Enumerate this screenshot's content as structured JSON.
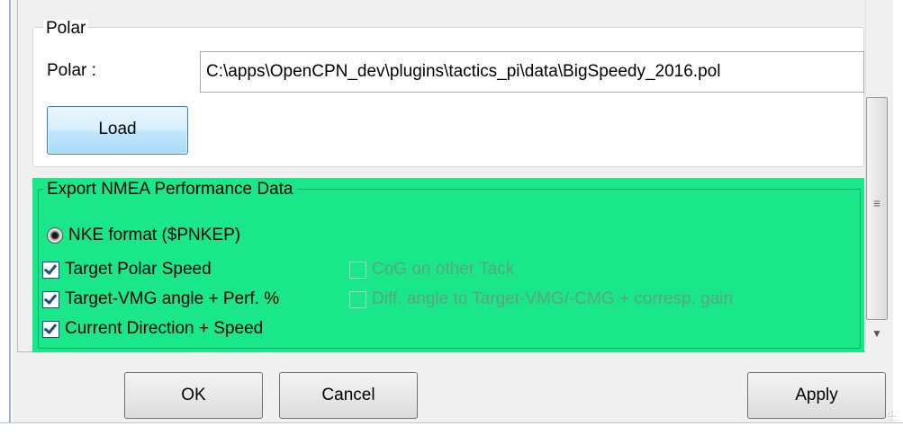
{
  "polar_group": {
    "legend": "Polar",
    "label": "Polar :",
    "file_path": "C:\\apps\\OpenCPN_dev\\plugins\\tactics_pi\\data\\BigSpeedy_2016.pol",
    "load_button": "Load"
  },
  "export_group": {
    "legend": "Export NMEA Performance Data",
    "background_color": "#1ae78a",
    "radio": {
      "label": "NKE format ($PNKEP)",
      "selected": true
    },
    "checkboxes_left": [
      {
        "label": "Target Polar Speed",
        "checked": true,
        "enabled": true
      },
      {
        "label": "Target-VMG angle + Perf. %",
        "checked": true,
        "enabled": true
      },
      {
        "label": "Current Direction + Speed",
        "checked": true,
        "enabled": true
      }
    ],
    "checkboxes_right": [
      {
        "label": "CoG on other Tack",
        "checked": false,
        "enabled": false
      },
      {
        "label": "Diff. angle to Target-VMG/-CMG + corresp. gain",
        "checked": false,
        "enabled": false
      }
    ]
  },
  "footer": {
    "ok_label": "OK",
    "cancel_label": "Cancel",
    "apply_label": "Apply"
  },
  "icons": {
    "scroll_grip": "grip-icon",
    "scroll_down": "arrow-down-icon",
    "resize": "resize-grip-icon"
  }
}
